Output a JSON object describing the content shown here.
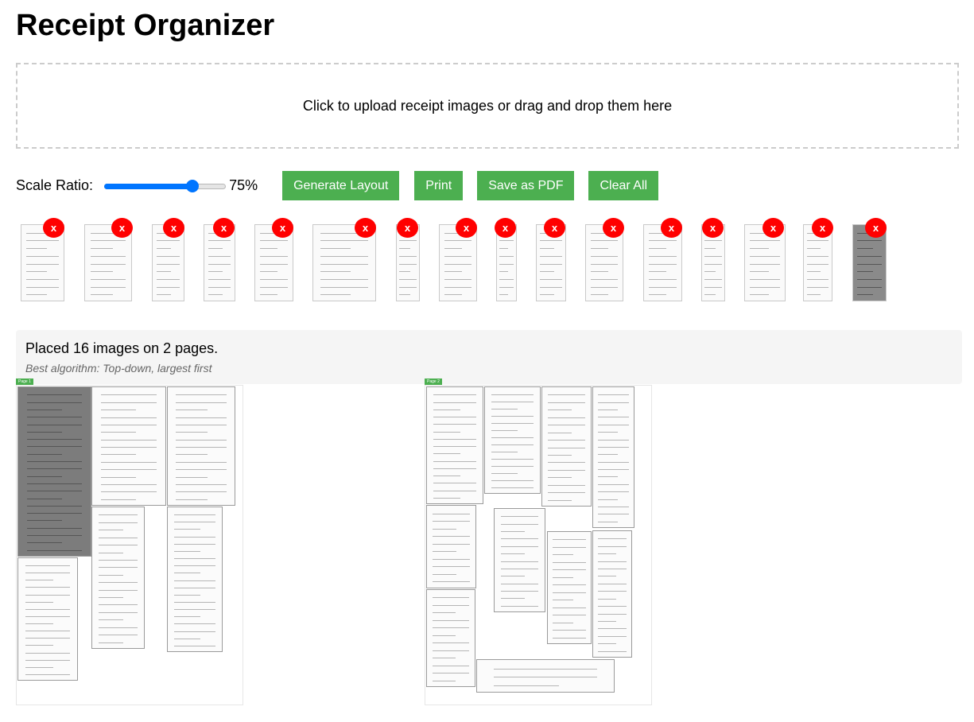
{
  "app": {
    "title": "Receipt Organizer"
  },
  "upload": {
    "prompt": "Click to upload receipt images or drag and drop them here"
  },
  "controls": {
    "scale_label": "Scale Ratio:",
    "scale_value": "75%",
    "scale_fraction": 0.75,
    "buttons": {
      "generate": "Generate Layout",
      "print": "Print",
      "save_pdf": "Save as PDF",
      "clear": "Clear All"
    }
  },
  "thumbnails": {
    "delete_label": "x",
    "count": 16
  },
  "result": {
    "summary": "Placed 16 images on 2 pages.",
    "algorithm": "Best algorithm: Top-down, largest first"
  },
  "pages": [
    {
      "badge": "Page 1"
    },
    {
      "badge": "Page 2"
    }
  ],
  "colors": {
    "accent": "#4caf50",
    "delete": "#ff0000",
    "slider": "#0075ff"
  }
}
